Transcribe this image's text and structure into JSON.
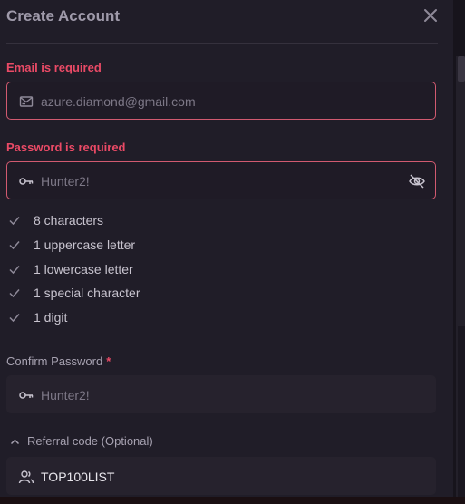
{
  "modal": {
    "title": "Create Account"
  },
  "email": {
    "error": "Email is required",
    "value": "azure.diamond@gmail.com"
  },
  "password": {
    "error": "Password is required",
    "value": "Hunter2!"
  },
  "requirements": [
    "8 characters",
    "1 uppercase letter",
    "1 lowercase letter",
    "1 special character",
    "1 digit"
  ],
  "confirm_password": {
    "label": "Confirm Password",
    "required_marker": "*",
    "value": "Hunter2!"
  },
  "referral": {
    "toggle_label": "Referral code (Optional)",
    "value": "TOP100LIST"
  },
  "colors": {
    "error": "#ea4a66",
    "modal_bg": "#201d28"
  }
}
